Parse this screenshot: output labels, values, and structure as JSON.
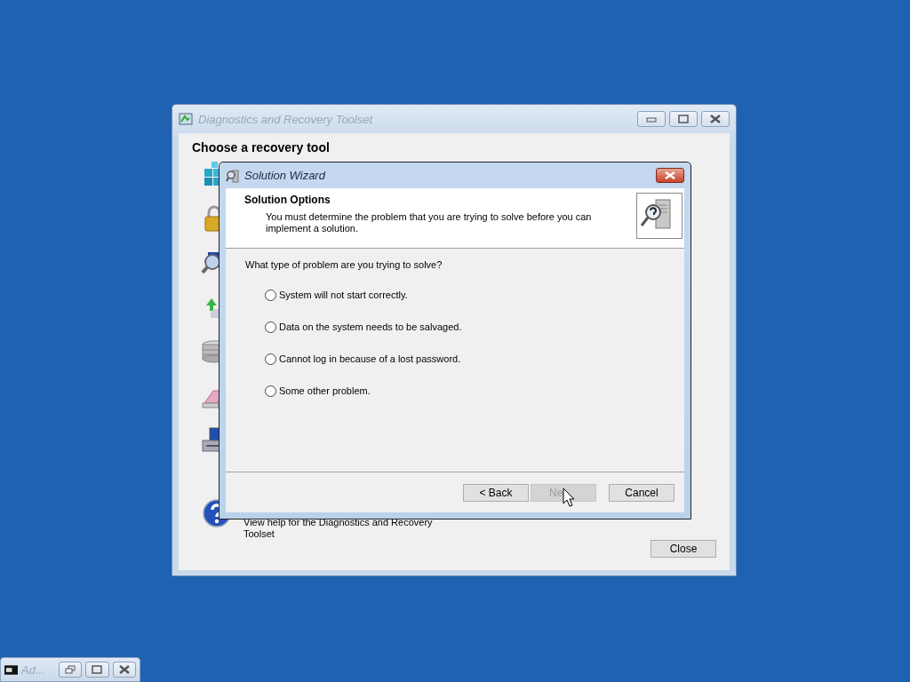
{
  "main_window": {
    "title": "Diagnostics and Recovery Toolset",
    "heading": "Choose a recovery tool",
    "help_text": "View help for the Diagnostics and Recovery Toolset",
    "close_button": "Close"
  },
  "dialog": {
    "title": "Solution Wizard",
    "header_title": "Solution Options",
    "header_description": "You must determine the problem that you are trying to solve before you can implement a solution.",
    "question": "What type of problem are you trying to solve?",
    "options": [
      {
        "label": "System will not start correctly.",
        "selected": false
      },
      {
        "label": "Data on the system needs to be salvaged.",
        "selected": false
      },
      {
        "label": "Cannot log in because of a lost password.",
        "selected": false
      },
      {
        "label": "Some other problem.",
        "selected": false
      }
    ],
    "buttons": [
      {
        "label": "< Back",
        "disabled": false
      },
      {
        "label": "Ne",
        "disabled": true
      },
      {
        "label": "Cancel",
        "disabled": false
      }
    ]
  },
  "minimized_window": {
    "title": "Ad..."
  }
}
